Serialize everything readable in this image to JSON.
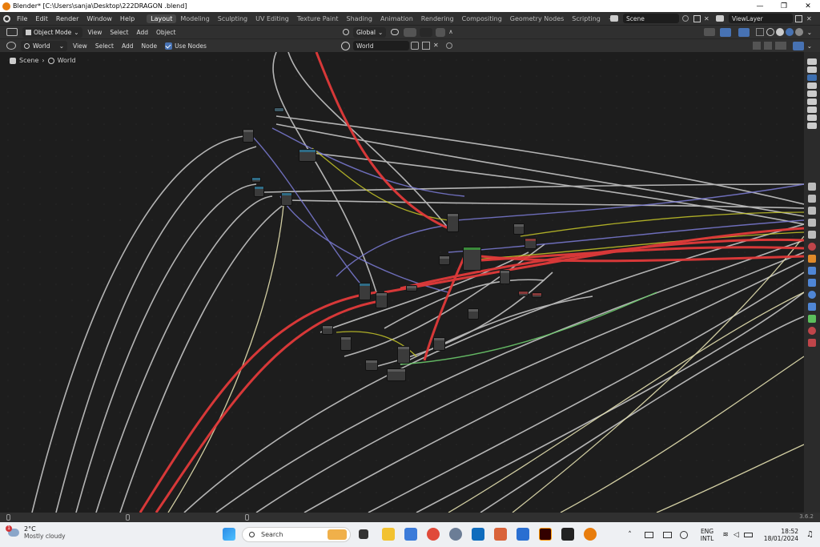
{
  "window": {
    "title": "Blender* [C:\\Users\\sanja\\Desktop\\222DRAGON .blend]",
    "controls": [
      "—",
      "❐",
      "✕"
    ]
  },
  "menubar": {
    "menus": [
      "File",
      "Edit",
      "Render",
      "Window",
      "Help"
    ],
    "workspaces": [
      "Layout",
      "Modeling",
      "Sculpting",
      "UV Editing",
      "Texture Paint",
      "Shading",
      "Animation",
      "Rendering",
      "Compositing",
      "Geometry Nodes",
      "Scripting"
    ],
    "active_workspace": "Layout",
    "add_tab": "+",
    "scene": "Scene",
    "view_layer": "ViewLayer"
  },
  "header1": {
    "mode": "Object Mode",
    "menus": [
      "View",
      "Select",
      "Add",
      "Object"
    ],
    "orientation": "Global"
  },
  "header2": {
    "shader_type": "World",
    "menus": [
      "View",
      "Select",
      "Add",
      "Node"
    ],
    "use_nodes_label": "Use Nodes",
    "use_nodes_checked": true,
    "world_name": "World"
  },
  "breadcrumb": {
    "items": [
      "Scene",
      "World"
    ]
  },
  "statusbar": {
    "version": "3.6.2"
  },
  "taskbar": {
    "weather_temp": "2°C",
    "weather_desc": "Mostly cloudy",
    "weather_badge": "1",
    "search_placeholder": "Search",
    "lang": "ENG",
    "layout": "INTL",
    "time": "18:52",
    "date": "18/01/2024"
  },
  "colors": {
    "accent": "#4772b3",
    "blender_orange": "#e87d0d",
    "wire_red": "#e03c3c",
    "wire_grey": "#c8c8c8",
    "wire_yellow": "#c7c729",
    "wire_purple": "#6363c7",
    "wire_green": "#63c763"
  }
}
